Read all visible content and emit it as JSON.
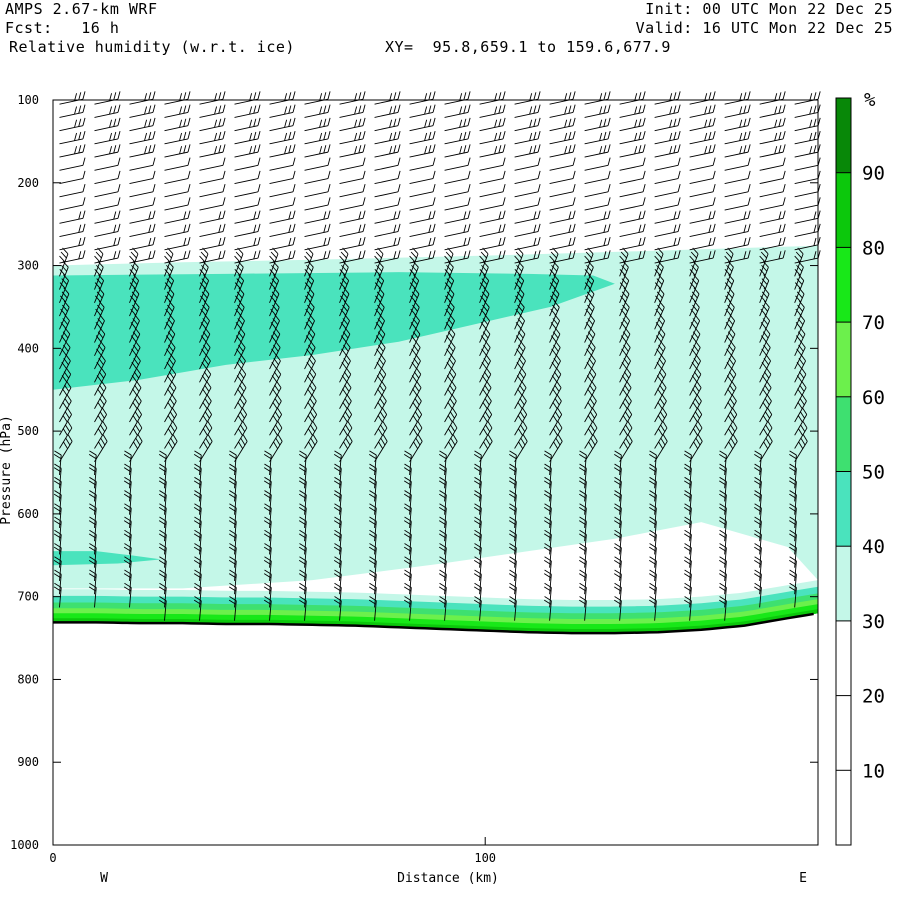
{
  "header": {
    "model": "AMPS 2.67-km WRF",
    "fcst": "Fcst:   16 h",
    "field": "Relative humidity (w.r.t. ice)",
    "xy": "XY=  95.8,659.1 to 159.6,677.9",
    "init": "Init: 00 UTC Mon 22 Dec 25",
    "valid": "Valid: 16 UTC Mon 22 Dec 25"
  },
  "chart_data": {
    "type": "cross-section",
    "title": "Relative humidity (w.r.t. ice)",
    "xlabel": "Distance (km)",
    "ylabel": "Pressure (hPa)",
    "xlim": [
      0,
      177
    ],
    "ylim": [
      1000,
      100
    ],
    "x_ticks": [
      0,
      100
    ],
    "y_ticks": [
      100,
      200,
      300,
      400,
      500,
      600,
      700,
      800,
      900,
      1000
    ],
    "left_end_label": "W",
    "right_end_label": "E",
    "surface_pressure": [
      [
        0,
        731
      ],
      [
        10,
        731
      ],
      [
        20,
        732
      ],
      [
        30,
        732
      ],
      [
        40,
        733
      ],
      [
        50,
        733
      ],
      [
        60,
        734
      ],
      [
        70,
        735
      ],
      [
        80,
        737
      ],
      [
        90,
        739
      ],
      [
        100,
        741
      ],
      [
        110,
        743
      ],
      [
        120,
        744
      ],
      [
        130,
        744
      ],
      [
        140,
        743
      ],
      [
        150,
        740
      ],
      [
        160,
        735
      ],
      [
        170,
        726
      ],
      [
        177,
        720
      ]
    ],
    "rh_regions": [
      {
        "min": 30,
        "color": "#c4f7e8",
        "upper": [
          [
            0,
            300
          ],
          [
            30,
            296
          ],
          [
            60,
            293
          ],
          [
            100,
            288
          ],
          [
            140,
            282
          ],
          [
            177,
            276
          ]
        ],
        "lower": [
          [
            0,
            690
          ],
          [
            30,
            690
          ],
          [
            60,
            680
          ],
          [
            90,
            660
          ],
          [
            110,
            645
          ],
          [
            130,
            630
          ],
          [
            150,
            610
          ],
          [
            170,
            640
          ],
          [
            177,
            680
          ]
        ]
      },
      {
        "min": 40,
        "color": "#4ae3bd",
        "upper": [
          [
            0,
            312
          ],
          [
            40,
            310
          ],
          [
            80,
            308
          ],
          [
            110,
            310
          ],
          [
            125,
            312
          ],
          [
            130,
            322
          ],
          [
            115,
            350
          ],
          [
            100,
            368
          ],
          [
            80,
            392
          ],
          [
            60,
            408
          ],
          [
            40,
            420
          ],
          [
            20,
            438
          ],
          [
            0,
            450
          ]
        ],
        "lower": []
      },
      {
        "min": 40,
        "color": "#4ae3bd",
        "upper": [
          [
            0,
            645
          ],
          [
            10,
            645
          ],
          [
            18,
            650
          ],
          [
            25,
            655
          ],
          [
            15,
            660
          ],
          [
            0,
            662
          ]
        ],
        "lower": []
      }
    ],
    "colorbar": {
      "unit": "%",
      "levels": [
        10,
        20,
        30,
        40,
        50,
        60,
        70,
        80,
        90
      ],
      "colors": [
        "#ffffff",
        "#ffffff",
        "#ffffff",
        "#c4f7e8",
        "#4ae3bd",
        "#3ee070",
        "#6cf04c",
        "#18e818",
        "#0cc80c",
        "#088808"
      ]
    }
  }
}
